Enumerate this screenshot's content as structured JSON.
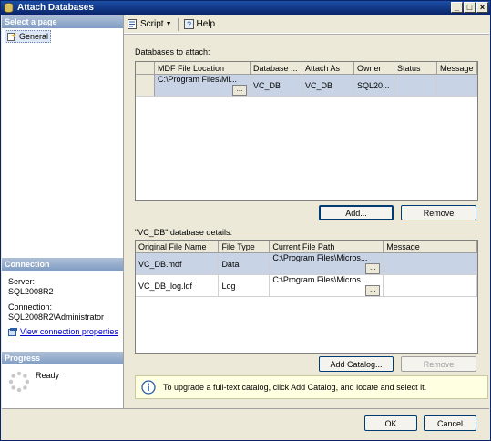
{
  "window": {
    "title": "Attach Databases",
    "controls": [
      "_",
      "□",
      "×"
    ]
  },
  "left": {
    "select_page_header": "Select a page",
    "nav_items": [
      {
        "label": "General",
        "icon": "page-icon"
      }
    ],
    "connection_header": "Connection",
    "server_label": "Server:",
    "server_value": "SQL2008R2",
    "connection_label": "Connection:",
    "connection_value": "SQL2008R2\\Administrator",
    "view_connection_link": "View connection properties",
    "progress_header": "Progress",
    "progress_status": "Ready"
  },
  "toolbar": {
    "script_label": "Script",
    "help_label": "Help"
  },
  "attach": {
    "label": "Databases to attach:",
    "columns": [
      "MDF File Location",
      "Database ...",
      "Attach As",
      "Owner",
      "Status",
      "Message"
    ],
    "rows": [
      {
        "mdf": "C:\\Program Files\\Mi...",
        "database": "VC_DB",
        "attach_as": "VC_DB",
        "owner": "SQL20...",
        "status": "",
        "message": ""
      }
    ],
    "add_button": "Add...",
    "remove_button": "Remove"
  },
  "details": {
    "label": "\"VC_DB\" database details:",
    "columns": [
      "Original File Name",
      "File Type",
      "Current File Path",
      "Message"
    ],
    "rows": [
      {
        "name": "VC_DB.mdf",
        "type": "Data",
        "path": "C:\\Program Files\\Micros...",
        "message": ""
      },
      {
        "name": "VC_DB_log.ldf",
        "type": "Log",
        "path": "C:\\Program Files\\Micros...",
        "message": ""
      }
    ],
    "add_catalog_button": "Add Catalog...",
    "remove_button": "Remove"
  },
  "info": {
    "text": "To upgrade a full-text catalog, click Add Catalog, and locate and select it."
  },
  "footer": {
    "ok_button": "OK",
    "cancel_button": "Cancel"
  },
  "colors": {
    "title_bar": "#0a246a",
    "section_header": "#7f9dc3",
    "selection": "#c8d4e6",
    "link": "#0000cc",
    "info_bg": "#ffffe1"
  }
}
